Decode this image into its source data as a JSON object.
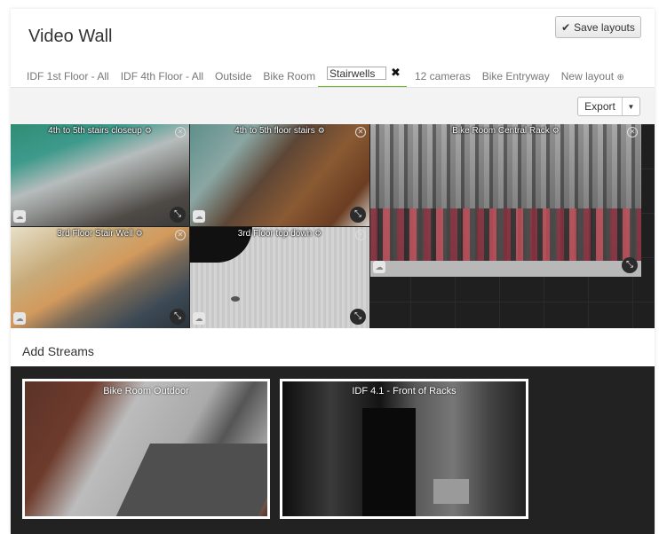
{
  "header": {
    "title": "Video Wall",
    "save_label": "Save layouts"
  },
  "tabs": [
    {
      "label": "IDF 1st Floor - All"
    },
    {
      "label": "IDF 4th Floor - All"
    },
    {
      "label": "Outside"
    },
    {
      "label": "Bike Room"
    }
  ],
  "active_tab": {
    "value": "Stairwells"
  },
  "tabs_after": [
    {
      "label": "12 cameras"
    },
    {
      "label": "Bike Entryway"
    },
    {
      "label": "New layout"
    }
  ],
  "toolbar": {
    "export_label": "Export"
  },
  "tiles": [
    {
      "caption": "4th to 5th stairs closeup"
    },
    {
      "caption": "4th to 5th floor stairs"
    },
    {
      "caption": "Bike Room Central Rack"
    },
    {
      "caption": "3rd Floor Stair Well"
    },
    {
      "caption": "3rd Floor top down"
    }
  ],
  "add_streams": {
    "title": "Add Streams",
    "streams": [
      {
        "caption": "Bike Room Outdoor"
      },
      {
        "caption": "IDF 4.1 - Front of Racks"
      }
    ]
  },
  "icons": {
    "check": "check-icon",
    "gear": "gear-icon",
    "close": "close-icon",
    "expand": "expand-icon",
    "cloud": "cloud-icon",
    "add": "plus-circle-icon",
    "caret": "caret-down-icon"
  },
  "colors": {
    "active_tab_underline": "#6bbd2b",
    "grid_background": "#1f1f1f",
    "streams_background": "#222222"
  }
}
